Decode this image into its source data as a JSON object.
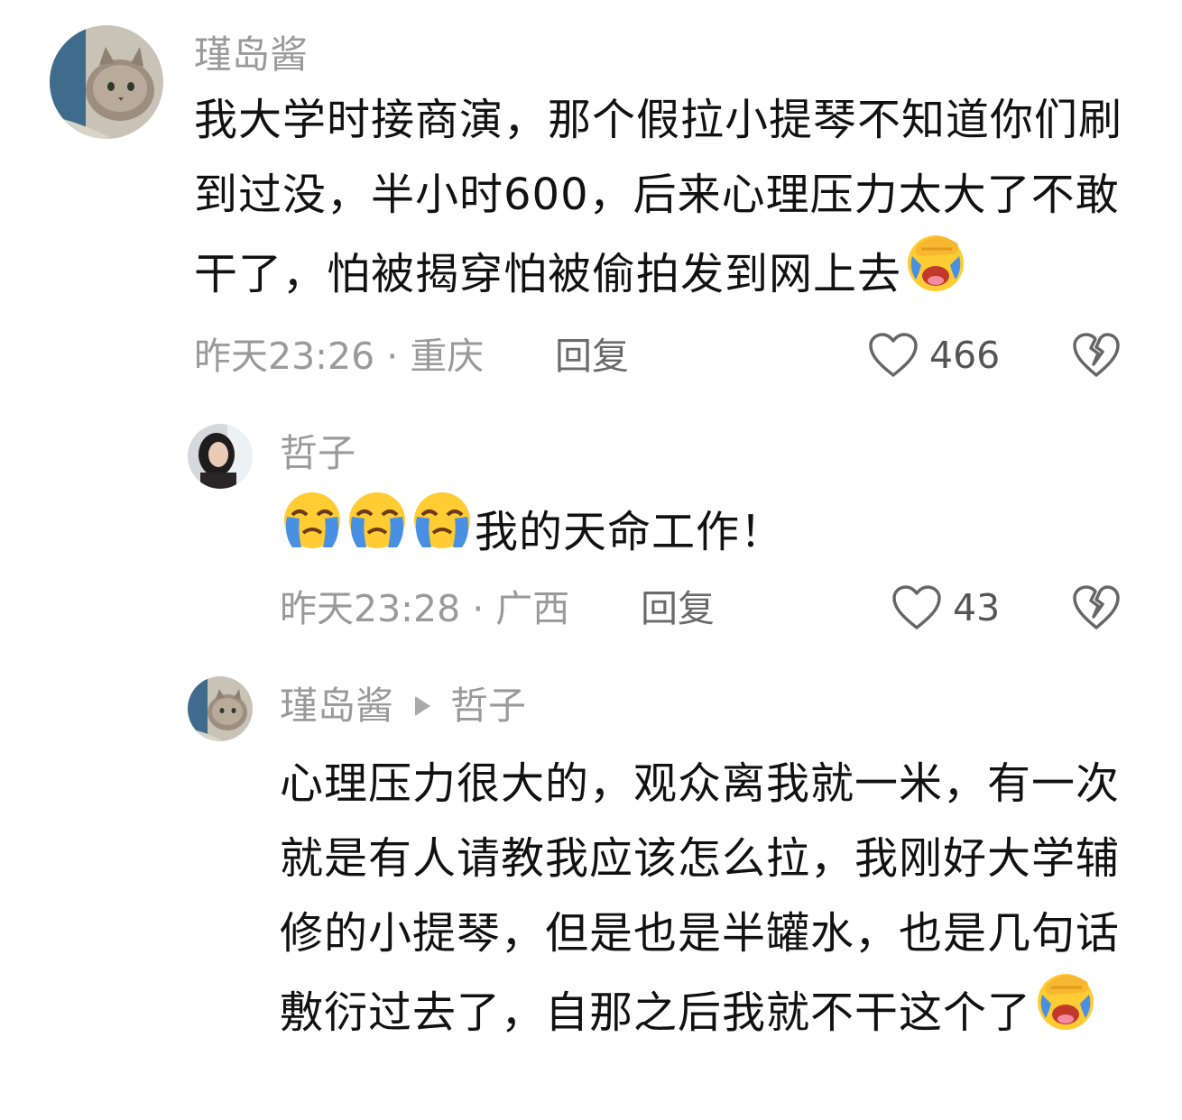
{
  "comments": [
    {
      "username": "瑾岛酱",
      "text": "我大学时接商演，那个假拉小提琴不知道你们刷到过没，半小时600，后来心理压力太大了不敢干了，怕被揭穿怕被偷拍发到网上去",
      "trailing_emoji": "face-palm-crying-emoji",
      "time": "昨天23:26",
      "separator": " · ",
      "location": "重庆",
      "reply_label": "回复",
      "likes": "466"
    },
    {
      "username": "哲子",
      "leading_emojis": [
        "loudly-crying-emoji",
        "loudly-crying-emoji",
        "loudly-crying-emoji"
      ],
      "text": "我的天命工作！",
      "time": "昨天23:28",
      "separator": " · ",
      "location": "广西",
      "reply_label": "回复",
      "likes": "43"
    },
    {
      "username": "瑾岛酱",
      "reply_to": "哲子",
      "text": "心理压力很大的，观众离我就一米，有一次就是有人请教我应该怎么拉，我刚好大学辅修的小提琴，但是也是半罐水，也是几句话敷衍过去了，自那之后我就不干这个了",
      "trailing_emoji": "face-palm-crying-emoji"
    }
  ],
  "colors": {
    "meta_gray": "#9a9a9a",
    "text": "#111111",
    "emoji_yellow": "#ffcc33",
    "tear_blue": "#4a90e2"
  }
}
